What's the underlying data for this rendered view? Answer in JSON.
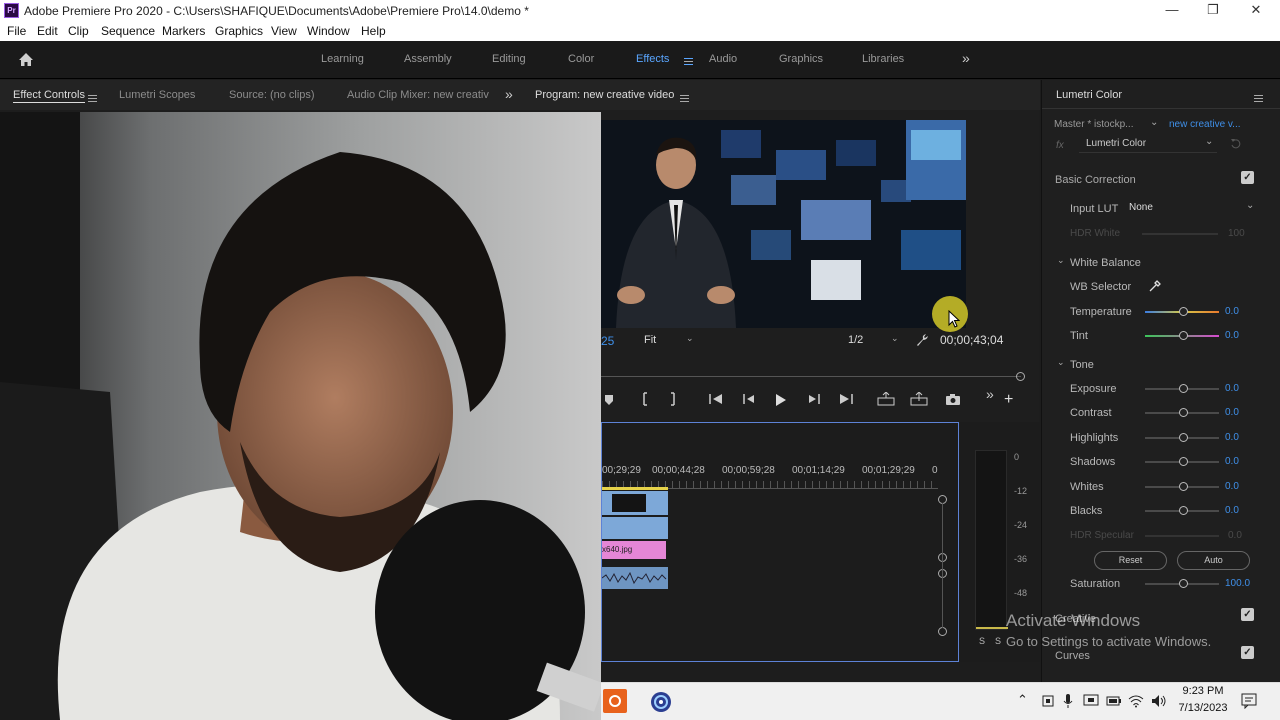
{
  "window": {
    "app_icon": "Pr",
    "title": "Adobe Premiere Pro 2020 - C:\\Users\\SHAFIQUE\\Documents\\Adobe\\Premiere Pro\\14.0\\demo *",
    "minimize": "—",
    "restore": "❐",
    "close": "✕"
  },
  "menu": [
    "File",
    "Edit",
    "Clip",
    "Sequence",
    "Markers",
    "Graphics",
    "View",
    "Window",
    "Help"
  ],
  "workspaces": {
    "items": [
      "Learning",
      "Assembly",
      "Editing",
      "Color",
      "Effects",
      "Audio",
      "Graphics",
      "Libraries"
    ],
    "active": "Effects",
    "more": "»"
  },
  "panels": {
    "effect_controls": "Effect Controls",
    "lumetri_scopes": "Lumetri Scopes",
    "source": "Source: (no clips)",
    "audio_mixer": "Audio Clip Mixer: new creativ",
    "more": "»",
    "program": "Program: new creative video"
  },
  "program_monitor": {
    "timecode_left": "25",
    "fit": "Fit",
    "resolution": "1/2",
    "timecode_right": "00;00;43;04"
  },
  "timeline": {
    "ruler": [
      "00;29;29",
      "00;00;44;28",
      "00;00;59;28",
      "00;01;14;29",
      "00;01;29;29",
      "0"
    ],
    "clip_label": "x640.jpg"
  },
  "audio_meter": {
    "scale": [
      "0",
      "-12",
      "-24",
      "-36",
      "-48"
    ],
    "solo_left": "S",
    "solo_right": "S"
  },
  "lumetri": {
    "title": "Lumetri Color",
    "master": "Master * istockp...",
    "sequence": "new creative v...",
    "fx_label": "fx",
    "effect": "Lumetri Color",
    "basic_correction": "Basic Correction",
    "input_lut_label": "Input LUT",
    "input_lut_value": "None",
    "hdr_white_label": "HDR White",
    "hdr_white_value": "100",
    "white_balance": "White Balance",
    "wb_selector": "WB Selector",
    "temperature_label": "Temperature",
    "temperature_value": "0.0",
    "tint_label": "Tint",
    "tint_value": "0.0",
    "tone": "Tone",
    "exposure_label": "Exposure",
    "exposure_value": "0.0",
    "contrast_label": "Contrast",
    "contrast_value": "0.0",
    "highlights_label": "Highlights",
    "highlights_value": "0.0",
    "shadows_label": "Shadows",
    "shadows_value": "0.0",
    "whites_label": "Whites",
    "whites_value": "0.0",
    "blacks_label": "Blacks",
    "blacks_value": "0.0",
    "hdr_specular_label": "HDR Specular",
    "hdr_specular_value": "0.0",
    "reset": "Reset",
    "auto": "Auto",
    "saturation_label": "Saturation",
    "saturation_value": "100.0",
    "creative": "Creative",
    "curves": "Curves"
  },
  "watermark": {
    "line1": "Activate Windows",
    "line2": "Go to Settings to activate Windows."
  },
  "taskbar": {
    "time": "9:23 PM",
    "date": "7/13/2023"
  },
  "colors": {
    "accent": "#3f8fe8",
    "timeline_border": "#5d82d6",
    "clip_blue": "#7da8d8",
    "clip_pink": "#e586d6"
  }
}
